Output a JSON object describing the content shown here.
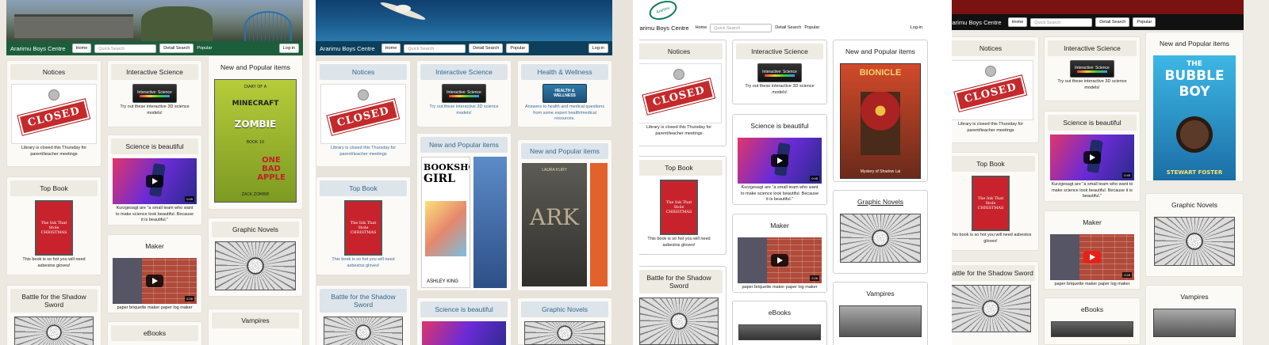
{
  "nav": {
    "brand": "Ararimu Boys Centre",
    "home": "Home",
    "search_placeholder": "Quick Search",
    "detail_search": "Detail Search",
    "popular": "Popular",
    "login": "Log-in"
  },
  "logo_text": "Ararimu",
  "cards": {
    "notices": "Notices",
    "closed_sign": "CLOSED",
    "notices_text": "Library is closed this Thursday for parent/teacher meetings",
    "interactive_science": "Interactive Science",
    "interactive_science_text": "Try out these interactive 3D science models!",
    "science_logo": "Interactive: Science",
    "science_beautiful": "Science is beautiful",
    "science_beautiful_text": "Kurzgesagt are \"a small team who want to make science look beautiful. Because it is beautiful.\"",
    "video_duration": "0:45",
    "top_book": "Top Book",
    "top_book_text": "This book is so hot you will need asbestos gloves!",
    "top_book_cover": "The Ink That Stole CHRISTMAS",
    "maker": "Maker",
    "maker_text": "paper briquette maker paper log maker",
    "maker_duration": "2:26",
    "new_popular": "New and Popular items",
    "graphic_novels": "Graphic Novels",
    "battle": "Battle for the Shadow Sword",
    "vampires": "Vampires",
    "ebooks": "eBooks",
    "health": "Health & Wellness",
    "health_logo": "HEALTH & WELLNESS",
    "health_text": "Answers to health and medical questions from some expert health/medical resources."
  },
  "books": {
    "minecraft": {
      "line1": "DIARY OF A",
      "line2": "MINECRAFT",
      "line3": "ZOMBIE",
      "line4": "BOOK 10",
      "line5": "ONE BAD APPLE",
      "author": "ZACK ZOMBIE"
    },
    "bionicle": {
      "title": "BIONICLE",
      "subtitle": "Mystery of Shadow Lai"
    },
    "bubble": {
      "line1": "THE",
      "line2": "BUBBLE",
      "line3": "BOY",
      "author": "STEWART FOSTER"
    },
    "bookshop": {
      "line1": "BOOKSHOP",
      "line2": "GIRL",
      "author": "ASHLEY KING"
    },
    "ark": {
      "author": "LAURA KURY",
      "title": "ARK"
    }
  },
  "colors": {
    "navbar_green": "#1c5e3c",
    "navbar_blue": "#0c3f5c",
    "navbar_dark": "#111111",
    "header_maroon": "#7a1212"
  }
}
